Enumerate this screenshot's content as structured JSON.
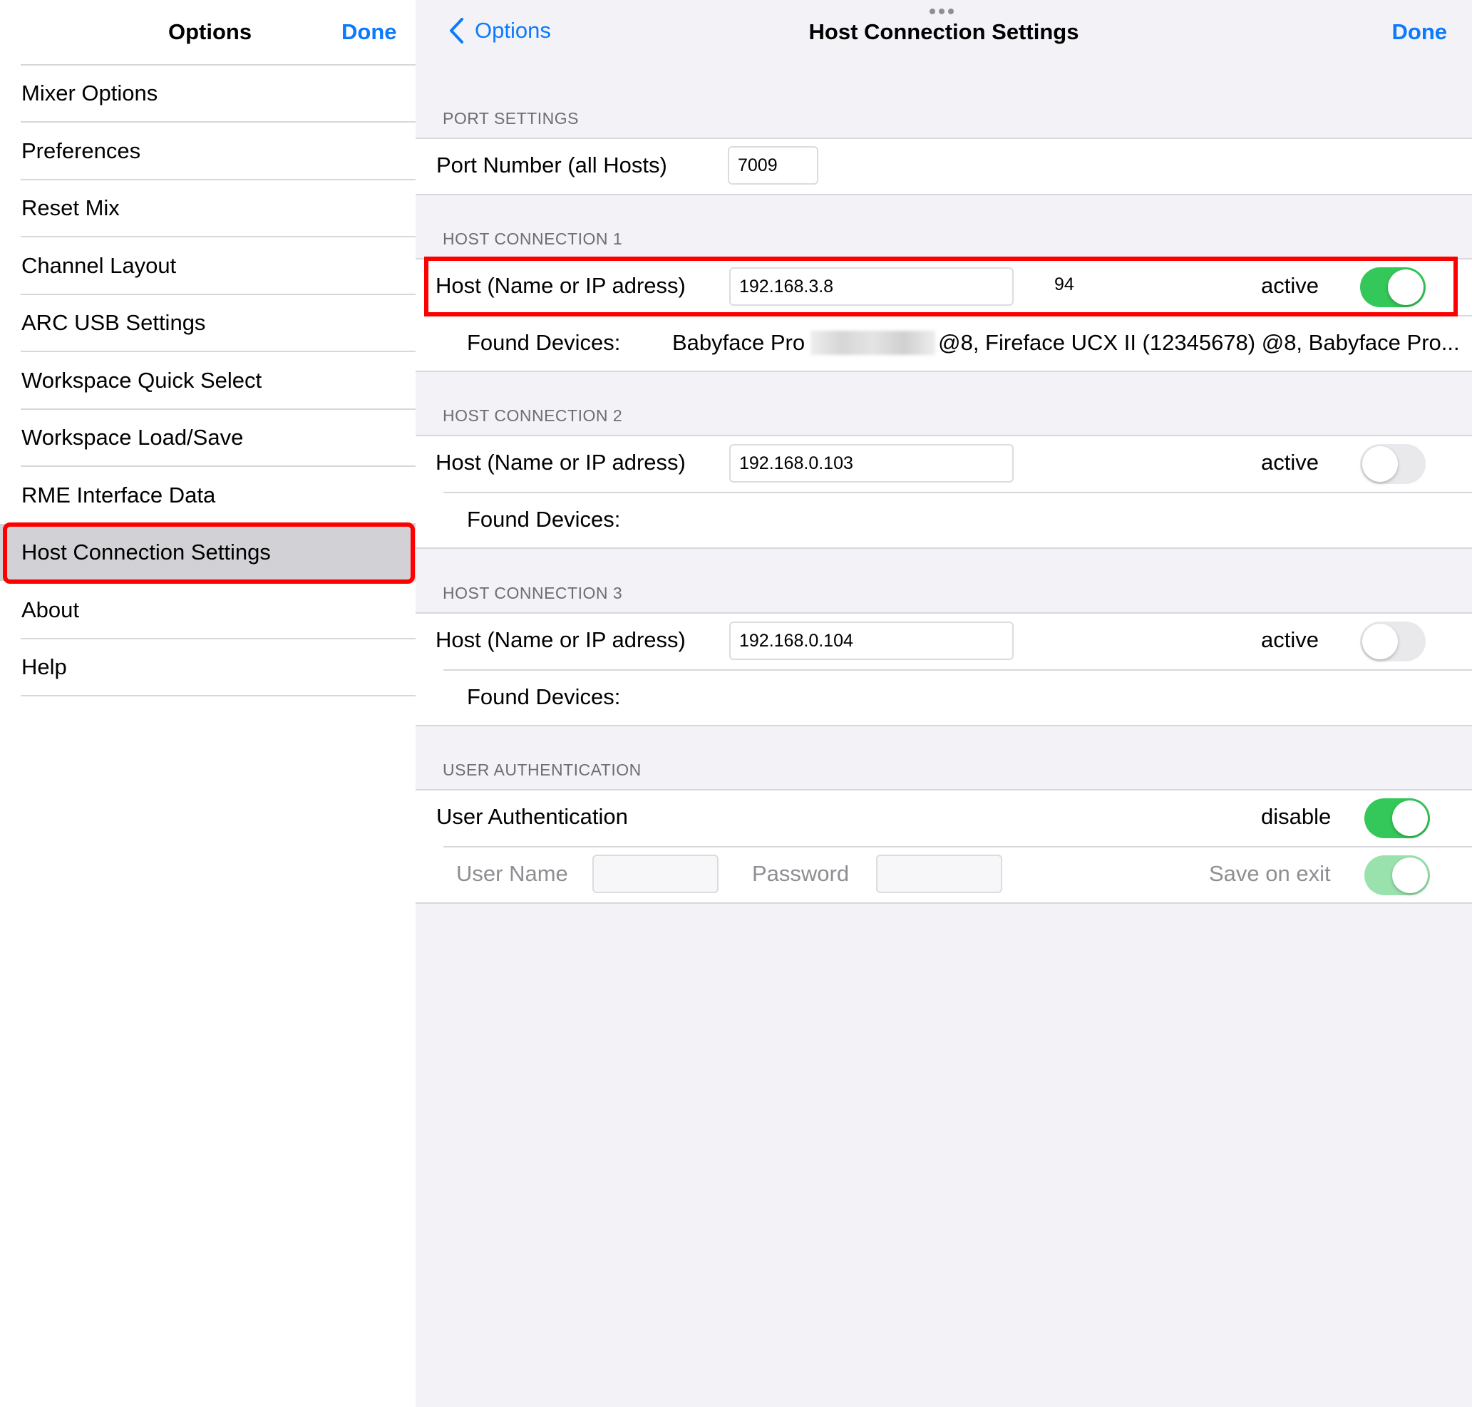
{
  "sidebar": {
    "title": "Options",
    "done": "Done",
    "items": [
      "Mixer Options",
      "Preferences",
      "Reset Mix",
      "Channel Layout",
      "ARC USB Settings",
      "Workspace Quick Select",
      "Workspace Load/Save",
      "RME Interface Data",
      "Host Connection Settings",
      "About",
      "Help"
    ],
    "selected": "Host Connection Settings"
  },
  "header": {
    "back": "Options",
    "title": "Host Connection Settings",
    "done": "Done"
  },
  "port": {
    "section": "PORT SETTINGS",
    "label": "Port Number (all Hosts)",
    "value": "7009"
  },
  "hosts": [
    {
      "section": "HOST CONNECTION 1",
      "label": "Host (Name or IP adress)",
      "value": "192.168.3.8",
      "count": "94",
      "active_label": "active",
      "active": true,
      "found_label": "Found Devices:",
      "found_a": "Babyface Pro",
      "found_b": "@8, Fireface UCX II (12345678) @8, Babyface Pro..."
    },
    {
      "section": "HOST CONNECTION 2",
      "label": "Host (Name or IP adress)",
      "value": "192.168.0.103",
      "active_label": "active",
      "active": false,
      "found_label": "Found Devices:"
    },
    {
      "section": "HOST CONNECTION 3",
      "label": "Host (Name or IP adress)",
      "value": "192.168.0.104",
      "active_label": "active",
      "active": false,
      "found_label": "Found Devices:"
    }
  ],
  "auth": {
    "section": "USER AUTHENTICATION",
    "label": "User Authentication",
    "disable_label": "disable",
    "disable": true,
    "username_label": "User Name",
    "username": "",
    "password_label": "Password",
    "password": "",
    "save_label": "Save on exit",
    "save": true
  },
  "colors": {
    "accent": "#0a7aff",
    "toggle_on": "#34c759",
    "highlight": "#ff0000"
  }
}
